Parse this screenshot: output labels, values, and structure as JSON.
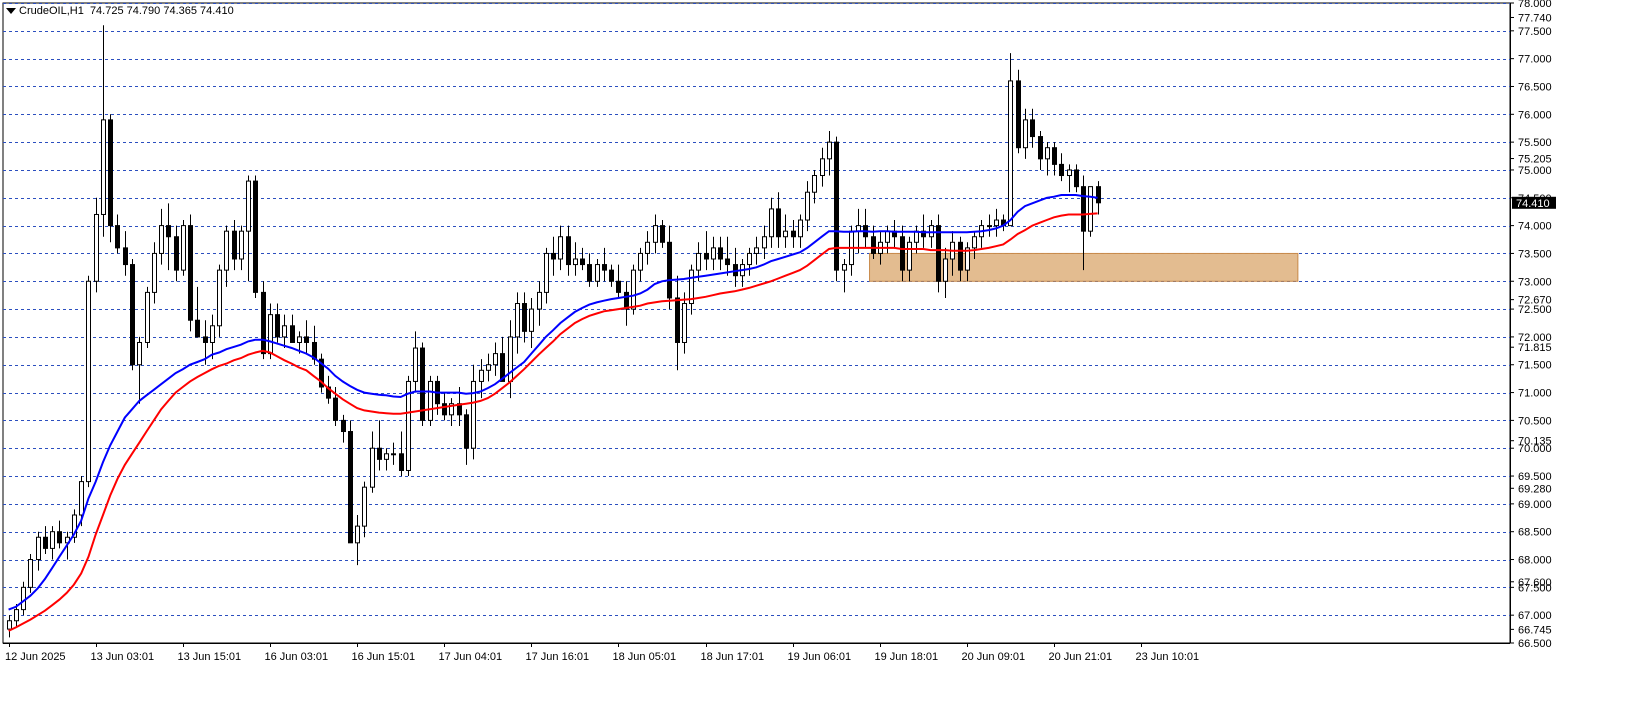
{
  "header": {
    "symbol": "CrudeOIL,H1",
    "ohlc": "74.725 74.790 74.365 74.410"
  },
  "colors": {
    "grid": "#2c4fbf",
    "ma_fast": "#0000ff",
    "ma_slow": "#ff0000",
    "zone": "#d9a56b",
    "bull": "#ffffff",
    "bear": "#000000"
  },
  "chart_data": {
    "type": "candlestick",
    "ylim": [
      66.5,
      78.0
    ],
    "y_ticks": [
      "78.000",
      "77.500",
      "77.000",
      "76.500",
      "76.000",
      "75.500",
      "75.000",
      "74.500",
      "74.000",
      "73.500",
      "73.000",
      "72.500",
      "72.000",
      "71.500",
      "71.000",
      "70.500",
      "70.000",
      "69.500",
      "69.000",
      "68.500",
      "68.000",
      "67.500",
      "67.000",
      "66.500"
    ],
    "extra_price_labels": [
      "77.740",
      "75.205",
      "72.670",
      "71.815",
      "70.135",
      "69.280",
      "67.600",
      "66.745"
    ],
    "current_price": 74.41,
    "x_labels": [
      {
        "label": "12 Jun 2025",
        "index": 0
      },
      {
        "label": "13 Jun 03:01",
        "index": 12
      },
      {
        "label": "13 Jun 15:01",
        "index": 24
      },
      {
        "label": "16 Jun 03:01",
        "index": 36
      },
      {
        "label": "16 Jun 15:01",
        "index": 48
      },
      {
        "label": "17 Jun 04:01",
        "index": 60
      },
      {
        "label": "17 Jun 16:01",
        "index": 72
      },
      {
        "label": "18 Jun 05:01",
        "index": 84
      },
      {
        "label": "18 Jun 17:01",
        "index": 96
      },
      {
        "label": "19 Jun 06:01",
        "index": 108
      },
      {
        "label": "19 Jun 18:01",
        "index": 120
      },
      {
        "label": "20 Jun 09:01",
        "index": 132
      },
      {
        "label": "20 Jun 21:01",
        "index": 144
      },
      {
        "label": "23 Jun 10:01",
        "index": 156
      }
    ],
    "candles": [
      [
        66.75,
        67.0,
        66.6,
        66.9
      ],
      [
        66.9,
        67.2,
        66.8,
        67.1
      ],
      [
        67.1,
        67.6,
        67.0,
        67.5
      ],
      [
        67.5,
        68.1,
        67.4,
        68.0
      ],
      [
        68.0,
        68.5,
        67.8,
        68.4
      ],
      [
        68.4,
        68.6,
        68.1,
        68.2
      ],
      [
        68.2,
        68.6,
        68.0,
        68.5
      ],
      [
        68.5,
        68.7,
        68.2,
        68.3
      ],
      [
        68.3,
        68.5,
        68.0,
        68.4
      ],
      [
        68.4,
        68.9,
        68.3,
        68.8
      ],
      [
        68.8,
        69.5,
        68.6,
        69.4
      ],
      [
        69.4,
        73.1,
        69.3,
        73.0
      ],
      [
        73.0,
        74.5,
        72.8,
        74.2
      ],
      [
        74.2,
        77.6,
        73.8,
        75.9
      ],
      [
        75.9,
        76.0,
        73.7,
        74.0
      ],
      [
        74.0,
        74.2,
        73.5,
        73.6
      ],
      [
        73.6,
        73.9,
        73.1,
        73.3
      ],
      [
        73.3,
        73.4,
        71.4,
        71.5
      ],
      [
        71.5,
        72.0,
        70.8,
        71.9
      ],
      [
        71.9,
        72.9,
        71.8,
        72.8
      ],
      [
        72.8,
        73.7,
        72.6,
        73.5
      ],
      [
        73.5,
        74.3,
        73.3,
        74.0
      ],
      [
        74.0,
        74.4,
        73.2,
        73.8
      ],
      [
        73.8,
        74.0,
        73.0,
        73.2
      ],
      [
        73.2,
        74.1,
        73.1,
        74.0
      ],
      [
        74.0,
        74.2,
        72.1,
        72.3
      ],
      [
        72.3,
        72.9,
        72.1,
        72.0
      ],
      [
        72.0,
        72.3,
        71.5,
        71.9
      ],
      [
        71.9,
        72.4,
        71.6,
        72.2
      ],
      [
        72.2,
        73.3,
        72.0,
        73.2
      ],
      [
        73.2,
        74.0,
        72.9,
        73.9
      ],
      [
        73.9,
        74.1,
        73.2,
        73.4
      ],
      [
        73.4,
        74.0,
        73.2,
        73.9
      ],
      [
        73.9,
        74.9,
        73.0,
        74.8
      ],
      [
        74.8,
        74.9,
        72.7,
        72.8
      ],
      [
        72.8,
        73.0,
        71.6,
        71.7
      ],
      [
        71.7,
        72.6,
        71.6,
        72.4
      ],
      [
        72.4,
        72.6,
        71.9,
        72.0
      ],
      [
        72.0,
        72.4,
        71.8,
        72.2
      ],
      [
        72.2,
        72.4,
        71.9,
        71.9
      ],
      [
        71.9,
        72.1,
        71.7,
        72.0
      ],
      [
        72.0,
        72.3,
        71.7,
        71.9
      ],
      [
        71.9,
        72.2,
        71.5,
        71.6
      ],
      [
        71.6,
        71.7,
        71.0,
        71.1
      ],
      [
        71.1,
        71.3,
        70.8,
        70.9
      ],
      [
        70.9,
        71.1,
        70.4,
        70.5
      ],
      [
        70.5,
        70.6,
        70.1,
        70.3
      ],
      [
        70.3,
        70.5,
        68.3,
        68.3
      ],
      [
        68.3,
        68.8,
        67.9,
        68.6
      ],
      [
        68.6,
        69.4,
        68.4,
        69.3
      ],
      [
        69.3,
        70.3,
        69.2,
        70.0
      ],
      [
        70.0,
        70.5,
        69.6,
        69.8
      ],
      [
        69.8,
        70.0,
        69.6,
        69.9
      ],
      [
        69.9,
        70.1,
        69.7,
        69.9
      ],
      [
        69.9,
        70.3,
        69.5,
        69.6
      ],
      [
        69.6,
        71.3,
        69.5,
        71.2
      ],
      [
        71.2,
        72.1,
        71.0,
        71.8
      ],
      [
        71.8,
        71.9,
        70.4,
        70.5
      ],
      [
        70.5,
        71.3,
        70.4,
        71.2
      ],
      [
        71.2,
        71.3,
        70.6,
        70.8
      ],
      [
        70.8,
        71.0,
        70.5,
        70.6
      ],
      [
        70.6,
        70.9,
        70.4,
        70.8
      ],
      [
        70.8,
        71.1,
        70.4,
        70.6
      ],
      [
        70.6,
        70.7,
        69.7,
        70.0
      ],
      [
        70.0,
        71.5,
        69.8,
        71.2
      ],
      [
        71.2,
        71.6,
        70.9,
        71.4
      ],
      [
        71.4,
        71.7,
        71.2,
        71.5
      ],
      [
        71.5,
        71.9,
        71.3,
        71.7
      ],
      [
        71.7,
        72.0,
        71.4,
        71.2
      ],
      [
        71.2,
        72.3,
        70.9,
        72.0
      ],
      [
        72.0,
        72.8,
        71.7,
        72.6
      ],
      [
        72.6,
        72.8,
        71.9,
        72.1
      ],
      [
        72.1,
        72.7,
        71.8,
        72.5
      ],
      [
        72.5,
        73.0,
        72.2,
        72.8
      ],
      [
        72.8,
        73.6,
        72.6,
        73.5
      ],
      [
        73.5,
        73.8,
        73.1,
        73.4
      ],
      [
        73.4,
        74.0,
        73.2,
        73.8
      ],
      [
        73.8,
        74.0,
        73.1,
        73.3
      ],
      [
        73.3,
        73.7,
        73.1,
        73.4
      ],
      [
        73.4,
        73.6,
        73.2,
        73.3
      ],
      [
        73.3,
        73.5,
        72.9,
        73.0
      ],
      [
        73.0,
        73.4,
        72.9,
        73.3
      ],
      [
        73.3,
        73.6,
        73.0,
        73.2
      ],
      [
        73.2,
        73.3,
        72.9,
        73.0
      ],
      [
        73.0,
        73.3,
        72.7,
        72.8
      ],
      [
        72.8,
        73.0,
        72.2,
        72.5
      ],
      [
        72.5,
        73.3,
        72.4,
        73.2
      ],
      [
        73.2,
        73.6,
        73.0,
        73.5
      ],
      [
        73.5,
        73.9,
        73.3,
        73.7
      ],
      [
        73.7,
        74.2,
        73.5,
        74.0
      ],
      [
        74.0,
        74.1,
        73.6,
        73.7
      ],
      [
        73.7,
        74.0,
        72.5,
        72.7
      ],
      [
        72.7,
        73.1,
        71.4,
        71.9
      ],
      [
        71.9,
        72.8,
        71.7,
        72.6
      ],
      [
        72.6,
        73.3,
        72.4,
        73.2
      ],
      [
        73.2,
        73.7,
        73.0,
        73.5
      ],
      [
        73.5,
        73.9,
        73.2,
        73.4
      ],
      [
        73.4,
        73.8,
        73.2,
        73.6
      ],
      [
        73.6,
        73.8,
        73.2,
        73.4
      ],
      [
        73.4,
        73.8,
        73.1,
        73.3
      ],
      [
        73.3,
        73.6,
        72.9,
        73.1
      ],
      [
        73.1,
        73.4,
        72.9,
        73.3
      ],
      [
        73.3,
        73.6,
        73.1,
        73.5
      ],
      [
        73.5,
        73.8,
        73.3,
        73.6
      ],
      [
        73.6,
        74.0,
        73.4,
        73.8
      ],
      [
        73.8,
        74.5,
        73.6,
        74.3
      ],
      [
        74.3,
        74.6,
        73.6,
        73.8
      ],
      [
        73.8,
        74.2,
        73.6,
        73.9
      ],
      [
        73.9,
        74.1,
        73.6,
        73.8
      ],
      [
        73.8,
        74.2,
        73.6,
        74.1
      ],
      [
        74.1,
        74.8,
        73.9,
        74.6
      ],
      [
        74.6,
        75.0,
        74.4,
        74.9
      ],
      [
        74.9,
        75.4,
        74.7,
        75.2
      ],
      [
        75.2,
        75.7,
        74.9,
        75.5
      ],
      [
        75.5,
        75.6,
        73.0,
        73.2
      ],
      [
        73.2,
        73.4,
        72.8,
        73.3
      ],
      [
        73.3,
        74.0,
        73.1,
        73.9
      ],
      [
        73.9,
        74.3,
        73.5,
        74.0
      ],
      [
        74.0,
        74.3,
        73.6,
        73.8
      ],
      [
        73.8,
        74.0,
        73.4,
        73.5
      ],
      [
        73.5,
        73.9,
        73.3,
        73.7
      ],
      [
        73.7,
        74.0,
        73.5,
        73.9
      ],
      [
        73.9,
        74.1,
        73.6,
        73.8
      ],
      [
        73.8,
        74.0,
        73.0,
        73.2
      ],
      [
        73.2,
        73.8,
        73.0,
        73.7
      ],
      [
        73.7,
        74.0,
        73.5,
        73.9
      ],
      [
        73.9,
        74.2,
        73.6,
        73.8
      ],
      [
        73.8,
        74.1,
        73.6,
        74.0
      ],
      [
        74.0,
        74.2,
        72.8,
        73.0
      ],
      [
        73.0,
        73.6,
        72.7,
        73.4
      ],
      [
        73.4,
        73.9,
        73.1,
        73.7
      ],
      [
        73.7,
        73.8,
        73.0,
        73.2
      ],
      [
        73.2,
        73.7,
        73.0,
        73.6
      ],
      [
        73.6,
        73.9,
        73.4,
        73.8
      ],
      [
        73.8,
        74.1,
        73.6,
        74.0
      ],
      [
        74.0,
        74.2,
        73.8,
        74.0
      ],
      [
        74.0,
        74.3,
        73.8,
        74.1
      ],
      [
        74.1,
        74.2,
        73.9,
        74.0
      ],
      [
        74.0,
        77.1,
        75.3,
        76.6
      ],
      [
        76.6,
        76.8,
        75.3,
        75.4
      ],
      [
        75.4,
        76.1,
        75.2,
        75.9
      ],
      [
        75.9,
        76.1,
        75.4,
        75.6
      ],
      [
        75.6,
        75.7,
        75.0,
        75.2
      ],
      [
        75.2,
        75.5,
        74.9,
        75.4
      ],
      [
        75.4,
        75.5,
        74.9,
        75.1
      ],
      [
        75.1,
        75.3,
        74.8,
        74.9
      ],
      [
        74.9,
        75.1,
        74.6,
        75.0
      ],
      [
        75.0,
        75.1,
        74.6,
        74.7
      ],
      [
        74.7,
        74.9,
        73.2,
        73.9
      ],
      [
        73.9,
        74.7,
        73.8,
        74.7
      ],
      [
        74.7,
        74.8,
        74.2,
        74.41
      ]
    ],
    "ma_fast": [
      67.1,
      67.15,
      67.25,
      67.35,
      67.48,
      67.65,
      67.85,
      68.05,
      68.25,
      68.45,
      68.7,
      69.1,
      69.4,
      69.75,
      70.05,
      70.3,
      70.55,
      70.7,
      70.85,
      70.95,
      71.05,
      71.15,
      71.25,
      71.35,
      71.42,
      71.5,
      71.55,
      71.6,
      71.68,
      71.72,
      71.78,
      71.82,
      71.86,
      71.92,
      71.95,
      71.95,
      71.92,
      71.88,
      71.84,
      71.8,
      71.75,
      71.7,
      71.63,
      71.53,
      71.43,
      71.3,
      71.2,
      71.12,
      71.05,
      71.0,
      70.98,
      70.96,
      70.95,
      70.93,
      70.92,
      70.98,
      71.02,
      71.02,
      71.02,
      71.0,
      71.0,
      71.0,
      71.0,
      70.98,
      70.99,
      71.02,
      71.08,
      71.15,
      71.25,
      71.35,
      71.45,
      71.55,
      71.7,
      71.85,
      72.0,
      72.12,
      72.25,
      72.35,
      72.45,
      72.52,
      72.58,
      72.62,
      72.65,
      72.68,
      72.7,
      72.72,
      72.74,
      72.78,
      72.85,
      72.95,
      73.0,
      73.02,
      73.03,
      73.04,
      73.06,
      73.08,
      73.1,
      73.12,
      73.14,
      73.16,
      73.18,
      73.2,
      73.22,
      73.25,
      73.3,
      73.36,
      73.4,
      73.44,
      73.48,
      73.52,
      73.6,
      73.7,
      73.8,
      73.9,
      73.9,
      73.89,
      73.89,
      73.9,
      73.9,
      73.89,
      73.9,
      73.9,
      73.89,
      73.89,
      73.89,
      73.89,
      73.88,
      73.88,
      73.88,
      73.88,
      73.88,
      73.88,
      73.88,
      73.89,
      73.9,
      73.92,
      73.95,
      74.0,
      74.1,
      74.25,
      74.35,
      74.4,
      74.45,
      74.5,
      74.52,
      74.55,
      74.55,
      74.55,
      74.53,
      74.52,
      74.5
    ],
    "ma_slow": [
      66.72,
      66.78,
      66.85,
      66.92,
      67.0,
      67.08,
      67.18,
      67.28,
      67.4,
      67.55,
      67.75,
      68.05,
      68.45,
      68.8,
      69.15,
      69.45,
      69.7,
      69.9,
      70.1,
      70.3,
      70.5,
      70.7,
      70.85,
      71.0,
      71.1,
      71.2,
      71.28,
      71.35,
      71.42,
      71.48,
      71.52,
      71.58,
      71.62,
      71.68,
      71.72,
      71.75,
      71.72,
      71.65,
      71.58,
      71.52,
      71.45,
      71.4,
      71.3,
      71.2,
      71.08,
      70.98,
      70.88,
      70.8,
      70.72,
      70.68,
      70.66,
      70.64,
      70.63,
      70.62,
      70.62,
      70.64,
      70.66,
      70.68,
      70.7,
      70.72,
      70.74,
      70.76,
      70.78,
      70.8,
      70.82,
      70.85,
      70.9,
      70.98,
      71.08,
      71.18,
      71.3,
      71.42,
      71.55,
      71.68,
      71.8,
      71.92,
      72.05,
      72.15,
      72.25,
      72.32,
      72.38,
      72.42,
      72.46,
      72.48,
      72.5,
      72.52,
      72.54,
      72.56,
      72.6,
      72.62,
      72.64,
      72.65,
      72.66,
      72.67,
      72.68,
      72.7,
      72.72,
      72.75,
      72.78,
      72.8,
      72.82,
      72.85,
      72.88,
      72.92,
      72.96,
      73.0,
      73.05,
      73.1,
      73.15,
      73.2,
      73.28,
      73.38,
      73.48,
      73.58,
      73.6,
      73.6,
      73.6,
      73.6,
      73.6,
      73.6,
      73.6,
      73.6,
      73.6,
      73.58,
      73.58,
      73.58,
      73.58,
      73.56,
      73.56,
      73.56,
      73.55,
      73.55,
      73.55,
      73.56,
      73.58,
      73.6,
      73.63,
      73.66,
      73.75,
      73.85,
      73.92,
      74.0,
      74.05,
      74.1,
      74.15,
      74.18,
      74.2,
      74.2,
      74.2,
      74.21,
      74.22
    ],
    "zone": {
      "price_low": 73.0,
      "price_high": 73.5,
      "from_index": 119,
      "to_index": 178
    }
  }
}
